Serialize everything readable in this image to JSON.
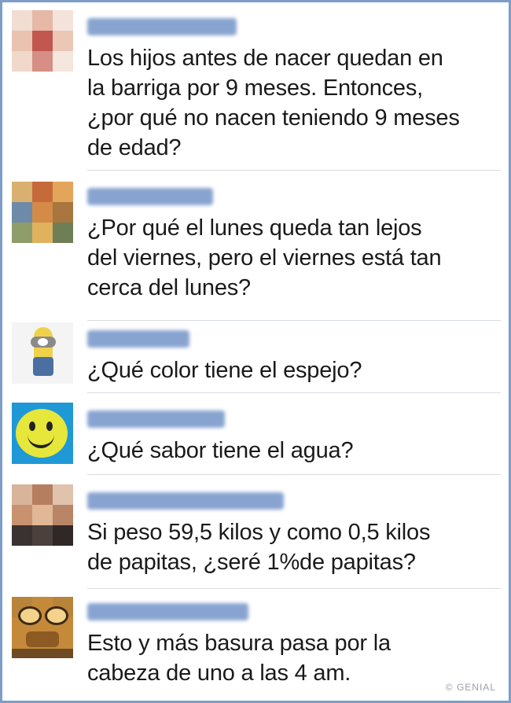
{
  "comments": [
    {
      "avatar": "blurred-profile-photo-open-mouth",
      "text": "Los hijos antes de nacer quedan en\nla barriga por 9 meses. Entonces,\n¿por qué no nacen teniendo 9 meses\nde edad?"
    },
    {
      "avatar": "blurred-profile-photo-cartoon-character",
      "text": "¿Por qué el lunes queda tan lejos\ndel viernes, pero el viernes está tan\ncerca del lunes?"
    },
    {
      "avatar": "minion-avatar",
      "text": "¿Qué color tiene el espejo?"
    },
    {
      "avatar": "smiley-face-avatar",
      "text": "¿Qué sabor tiene el agua?"
    },
    {
      "avatar": "blurred-profile-photo-person",
      "text": "Si peso 59,5 kilos y como 0,5 kilos\nde papitas, ¿seré 1%de papitas?"
    },
    {
      "avatar": "cartoon-face-with-glasses-avatar",
      "text": "Esto y más basura pasa por la\ncabeza de uno a las 4 am."
    }
  ],
  "watermark": "© GENIAL",
  "colors": {
    "frame_border": "#7d9dc6",
    "username_blur": "#6f8fc4",
    "divider": "#d7dbe3"
  }
}
